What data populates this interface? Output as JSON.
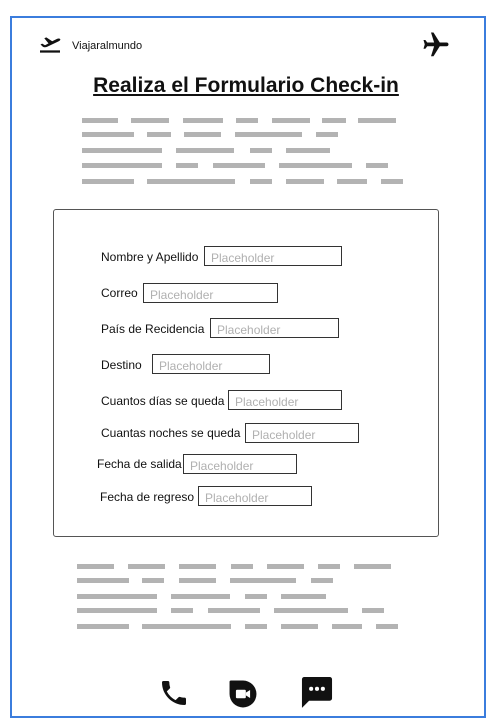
{
  "header": {
    "brand_name": "Viajaralmundo",
    "brand_icon": "airplane-departure-icon",
    "right_icon": "airplane-icon"
  },
  "title": "Realiza el Formulario Check-in",
  "form": {
    "fields": [
      {
        "label": "Nombre y Apellido",
        "placeholder": "Placeholder"
      },
      {
        "label": "Correo",
        "placeholder": "Placeholder"
      },
      {
        "label": "País de Recidencia",
        "placeholder": "Placeholder"
      },
      {
        "label": "Destino",
        "placeholder": "Placeholder"
      },
      {
        "label": "Cuantos días se queda",
        "placeholder": "Placeholder"
      },
      {
        "label": "Cuantas noches se queda",
        "placeholder": "Placeholder"
      },
      {
        "label": "Fecha de salida",
        "placeholder": "Placeholder"
      },
      {
        "label": "Fecha de regreso",
        "placeholder": "Placeholder"
      }
    ]
  },
  "footer": {
    "icons": [
      "phone-icon",
      "video-call-icon",
      "chat-icon"
    ]
  },
  "colors": {
    "frame_border": "#3b7ddd",
    "placeholder_text": "#b3b3b3",
    "icon": "#111111"
  }
}
